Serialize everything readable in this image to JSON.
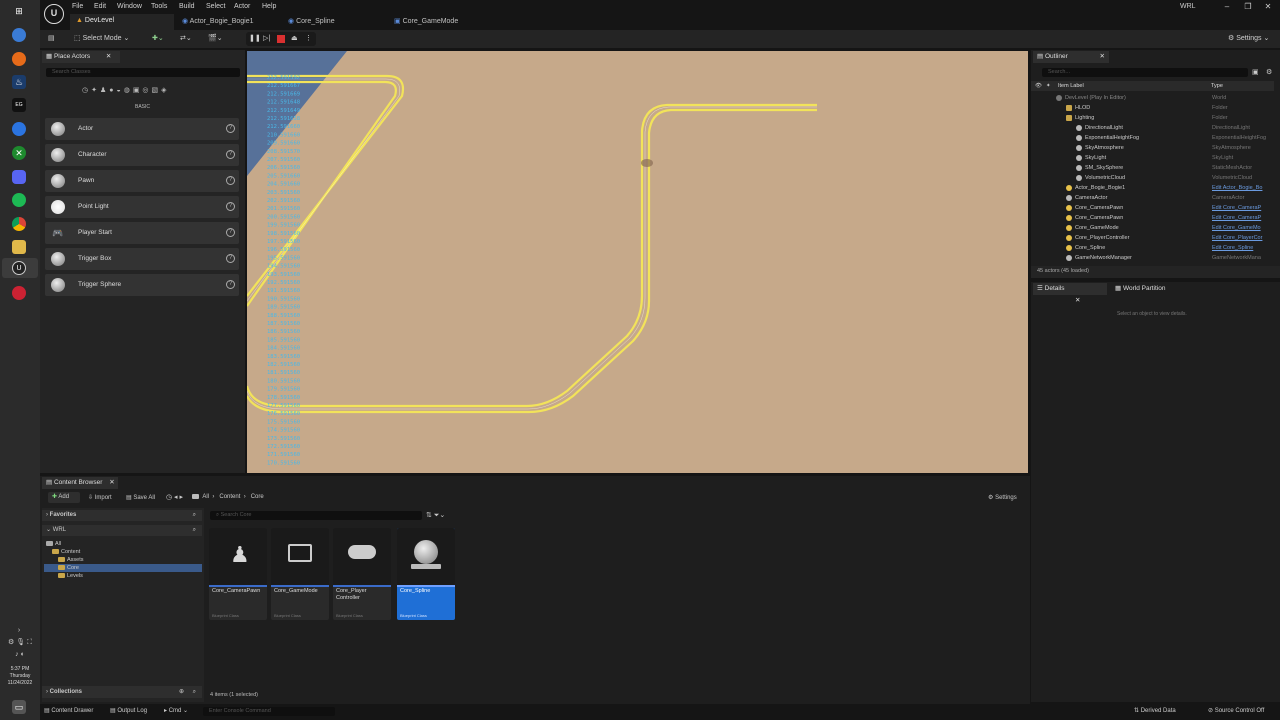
{
  "taskbar": {
    "time": "5:37 PM",
    "day": "Thursday",
    "date": "11/24/2022"
  },
  "menu": {
    "items": [
      "File",
      "Edit",
      "Window",
      "Tools",
      "Build",
      "Select",
      "Actor",
      "Help"
    ]
  },
  "doc_tabs": [
    {
      "label": "DevLevel",
      "active": true
    },
    {
      "label": "Actor_Bogie_Bogie1",
      "active": false
    },
    {
      "label": "Core_Spline",
      "active": false
    },
    {
      "label": "Core_GameMode",
      "active": false
    }
  ],
  "project_name": "WRL",
  "toolbar": {
    "select_mode": "Select Mode",
    "settings": "Settings"
  },
  "place_actors": {
    "tab_label": "Place Actors",
    "search_placeholder": "Search Classes",
    "category": "BASIC",
    "items": [
      "Actor",
      "Character",
      "Pawn",
      "Point Light",
      "Player Start",
      "Trigger Box",
      "Trigger Sphere"
    ]
  },
  "viewport": {
    "debug_numbers": [
      "212.591592",
      "212.591667",
      "212.591669",
      "212.591648",
      "212.591649",
      "212.591658",
      "212.591660",
      "210.591660",
      "209.591660",
      "208.591570",
      "207.591560",
      "206.591560",
      "205.591660",
      "204.591660",
      "203.591560",
      "202.591560",
      "201.591560",
      "200.591560",
      "199.591560",
      "198.591560",
      "197.591560",
      "196.591560",
      "195.591560",
      "194.591560",
      "193.591560",
      "192.591560",
      "191.591560",
      "190.591560",
      "189.591560",
      "188.591560",
      "187.591560",
      "186.591560",
      "185.591560",
      "184.591560",
      "183.591560",
      "182.591560",
      "181.591560",
      "180.591560",
      "179.591560",
      "178.591560",
      "177.591560",
      "176.591560",
      "175.591560",
      "174.591560",
      "173.591560",
      "172.591560",
      "171.591560",
      "170.591560"
    ]
  },
  "outliner": {
    "tab_label": "Outliner",
    "search_placeholder": "Search...",
    "col_label": "Item Label",
    "col_type": "Type",
    "rows": [
      {
        "label": "DevLevel (Play In Editor)",
        "type": "World",
        "indent": 0,
        "link": false
      },
      {
        "label": "HLOD",
        "type": "Folder",
        "indent": 1,
        "link": false
      },
      {
        "label": "Lighting",
        "type": "Folder",
        "indent": 1,
        "link": false
      },
      {
        "label": "DirectionalLight",
        "type": "DirectionalLight",
        "indent": 2,
        "link": false
      },
      {
        "label": "ExponentialHeightFog",
        "type": "ExponentialHeightFog",
        "indent": 2,
        "link": false
      },
      {
        "label": "SkyAtmosphere",
        "type": "SkyAtmosphere",
        "indent": 2,
        "link": false
      },
      {
        "label": "SkyLight",
        "type": "SkyLight",
        "indent": 2,
        "link": false
      },
      {
        "label": "SM_SkySphere",
        "type": "StaticMeshActor",
        "indent": 2,
        "link": false
      },
      {
        "label": "VolumetricCloud",
        "type": "VolumetricCloud",
        "indent": 2,
        "link": false
      },
      {
        "label": "Actor_Bogie_Bogie1",
        "type": "Edit Actor_Bogie_Bo",
        "indent": 1,
        "link": true
      },
      {
        "label": "CameraActor",
        "type": "CameraActor",
        "indent": 1,
        "link": false
      },
      {
        "label": "Core_CameraPawn",
        "type": "Edit Core_CameraP",
        "indent": 1,
        "link": true
      },
      {
        "label": "Core_CameraPawn",
        "type": "Edit Core_CameraP",
        "indent": 1,
        "link": true
      },
      {
        "label": "Core_GameMode",
        "type": "Edit Core_GameMo",
        "indent": 1,
        "link": true
      },
      {
        "label": "Core_PlayerController",
        "type": "Edit Core_PlayerCor",
        "indent": 1,
        "link": true
      },
      {
        "label": "Core_Spline",
        "type": "Edit Core_Spline",
        "indent": 1,
        "link": true
      },
      {
        "label": "GameNetworkManager",
        "type": "GameNetworkMana",
        "indent": 1,
        "link": false
      }
    ],
    "footer": "45 actors (45 loaded)"
  },
  "details": {
    "tab_label": "Details",
    "tab2_label": "World Partition",
    "empty_text": "Select an object to view details."
  },
  "content_browser": {
    "tab_label": "Content Browser",
    "add": "Add",
    "import": "Import",
    "save_all": "Save All",
    "path": [
      "All",
      "Content",
      "Core"
    ],
    "settings": "Settings",
    "favorites": "Favorites",
    "project": "WRL",
    "tree": [
      "All",
      "Content",
      "Assets",
      "Core",
      "Levels"
    ],
    "search_placeholder": "Search Core",
    "collections": "Collections",
    "items_count": "4 items (1 selected)",
    "assets": [
      {
        "name": "Core_CameraPawn",
        "cls": "Blueprint Class",
        "selected": false
      },
      {
        "name": "Core_GameMode",
        "cls": "Blueprint Class",
        "selected": false
      },
      {
        "name": "Core_Player Controller",
        "cls": "Blueprint Class",
        "selected": false
      },
      {
        "name": "Core_Spline",
        "cls": "Blueprint Class",
        "selected": true
      }
    ]
  },
  "statusbar": {
    "content_drawer": "Content Drawer",
    "output_log": "Output Log",
    "cmd": "Cmd",
    "console_placeholder": "Enter Console Command",
    "derived_data": "Derived Data",
    "source_control": "Source Control Off"
  }
}
